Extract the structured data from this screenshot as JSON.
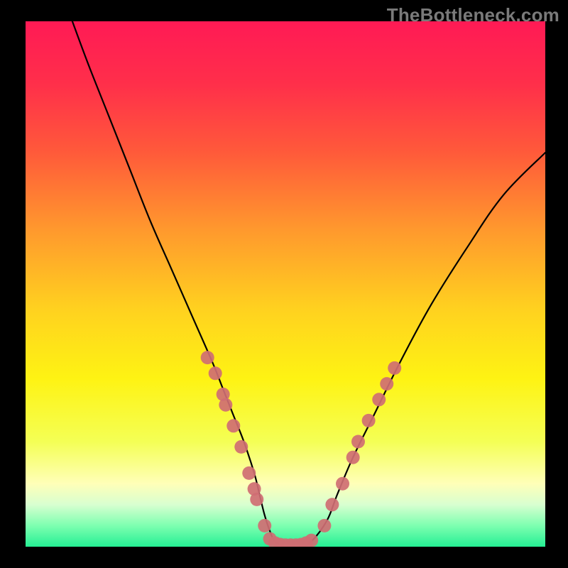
{
  "watermark": "TheBottleneck.com",
  "chart_data": {
    "type": "line",
    "title": "",
    "xlabel": "",
    "ylabel": "",
    "xlim": [
      0,
      100
    ],
    "ylim": [
      0,
      100
    ],
    "background": {
      "type": "vertical-gradient",
      "stops": [
        {
          "pos": 0.0,
          "color": "#ff1a55"
        },
        {
          "pos": 0.12,
          "color": "#ff2f4a"
        },
        {
          "pos": 0.25,
          "color": "#ff5a3a"
        },
        {
          "pos": 0.4,
          "color": "#ff9a2d"
        },
        {
          "pos": 0.55,
          "color": "#ffd21f"
        },
        {
          "pos": 0.68,
          "color": "#fef313"
        },
        {
          "pos": 0.8,
          "color": "#f4ff55"
        },
        {
          "pos": 0.88,
          "color": "#ffffb8"
        },
        {
          "pos": 0.92,
          "color": "#d8ffd0"
        },
        {
          "pos": 0.96,
          "color": "#7dffb0"
        },
        {
          "pos": 1.0,
          "color": "#25ef94"
        }
      ]
    },
    "series": [
      {
        "name": "bottleneck-curve",
        "color": "#000000",
        "x": [
          9,
          12,
          16,
          20,
          24,
          28,
          32,
          36,
          38,
          40,
          42,
          44,
          45,
          46,
          47,
          48,
          50,
          53,
          55,
          58,
          60,
          63,
          67,
          72,
          78,
          85,
          92,
          100
        ],
        "y": [
          100,
          92,
          82,
          72,
          62,
          53,
          44,
          35,
          30,
          25,
          20,
          14,
          10,
          6,
          3,
          1,
          0,
          0,
          1,
          5,
          10,
          17,
          25,
          35,
          46,
          57,
          67,
          75
        ]
      }
    ],
    "markers": [
      {
        "series": "bottleneck-curve",
        "x": 35,
        "y": 36,
        "color": "#cf6e73"
      },
      {
        "series": "bottleneck-curve",
        "x": 36.5,
        "y": 33,
        "color": "#cf6e73"
      },
      {
        "series": "bottleneck-curve",
        "x": 38,
        "y": 29,
        "color": "#cf6e73"
      },
      {
        "series": "bottleneck-curve",
        "x": 38.5,
        "y": 27,
        "color": "#cf6e73"
      },
      {
        "series": "bottleneck-curve",
        "x": 40,
        "y": 23,
        "color": "#cf6e73"
      },
      {
        "series": "bottleneck-curve",
        "x": 41.5,
        "y": 19,
        "color": "#cf6e73"
      },
      {
        "series": "bottleneck-curve",
        "x": 43,
        "y": 14,
        "color": "#cf6e73"
      },
      {
        "series": "bottleneck-curve",
        "x": 44,
        "y": 11,
        "color": "#cf6e73"
      },
      {
        "series": "bottleneck-curve",
        "x": 44.5,
        "y": 9,
        "color": "#cf6e73"
      },
      {
        "series": "bottleneck-curve",
        "x": 46,
        "y": 4,
        "color": "#cf6e73"
      },
      {
        "series": "bottleneck-curve",
        "x": 47,
        "y": 1.5,
        "color": "#cf6e73"
      },
      {
        "series": "bottleneck-curve",
        "x": 48,
        "y": 0.7,
        "color": "#cf6e73"
      },
      {
        "series": "bottleneck-curve",
        "x": 49,
        "y": 0.4,
        "color": "#cf6e73"
      },
      {
        "series": "bottleneck-curve",
        "x": 50,
        "y": 0.3,
        "color": "#cf6e73"
      },
      {
        "series": "bottleneck-curve",
        "x": 51,
        "y": 0.3,
        "color": "#cf6e73"
      },
      {
        "series": "bottleneck-curve",
        "x": 52,
        "y": 0.3,
        "color": "#cf6e73"
      },
      {
        "series": "bottleneck-curve",
        "x": 53,
        "y": 0.4,
        "color": "#cf6e73"
      },
      {
        "series": "bottleneck-curve",
        "x": 54,
        "y": 0.7,
        "color": "#cf6e73"
      },
      {
        "series": "bottleneck-curve",
        "x": 55,
        "y": 1.2,
        "color": "#cf6e73"
      },
      {
        "series": "bottleneck-curve",
        "x": 57.5,
        "y": 4,
        "color": "#cf6e73"
      },
      {
        "series": "bottleneck-curve",
        "x": 59,
        "y": 8,
        "color": "#cf6e73"
      },
      {
        "series": "bottleneck-curve",
        "x": 61,
        "y": 12,
        "color": "#cf6e73"
      },
      {
        "series": "bottleneck-curve",
        "x": 63,
        "y": 17,
        "color": "#cf6e73"
      },
      {
        "series": "bottleneck-curve",
        "x": 64,
        "y": 20,
        "color": "#cf6e73"
      },
      {
        "series": "bottleneck-curve",
        "x": 66,
        "y": 24,
        "color": "#cf6e73"
      },
      {
        "series": "bottleneck-curve",
        "x": 68,
        "y": 28,
        "color": "#cf6e73"
      },
      {
        "series": "bottleneck-curve",
        "x": 69.5,
        "y": 31,
        "color": "#cf6e73"
      },
      {
        "series": "bottleneck-curve",
        "x": 71,
        "y": 34,
        "color": "#cf6e73"
      }
    ]
  }
}
